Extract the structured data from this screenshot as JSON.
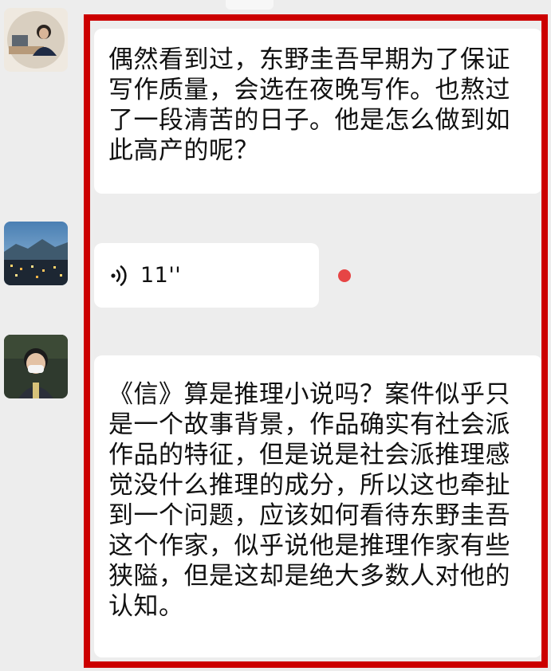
{
  "messages": {
    "m1": {
      "text": "偶然看到过，东野圭吾早期为了保证写作质量，会选在夜晚写作。也熬过了一段清苦的日子。他是怎么做到如此高产的呢？"
    },
    "voice": {
      "duration": "11''",
      "unread": true
    },
    "m3": {
      "text": "《信》算是推理小说吗？案件似乎只是一个故事背景，作品确实有社会派作品的特征，但是说是社会派推理感觉没什么推理的成分，所以这也牵扯到一个问题，应该如何看待东野圭吾这个作家，似乎说他是推理作家有些狭隘，但是这却是绝大多数人对他的认知。"
    }
  },
  "colors": {
    "background": "#ededed",
    "bubble": "#ffffff",
    "highlight_frame": "#cc0000",
    "unread_dot": "#e64545"
  },
  "icons": {
    "voice": "voice-wave-icon"
  }
}
